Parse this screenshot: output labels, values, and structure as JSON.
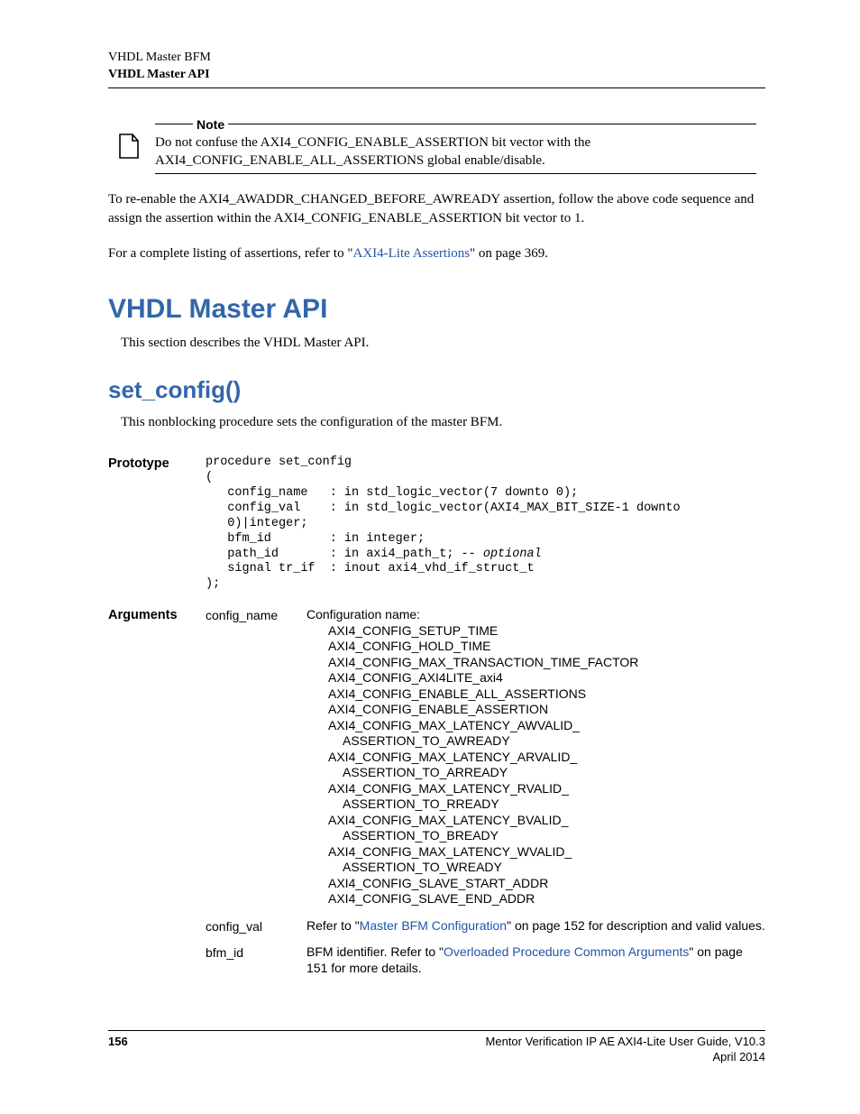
{
  "header": {
    "line1": "VHDL Master BFM",
    "line2": "VHDL Master API"
  },
  "note": {
    "label": "Note",
    "body": "Do not confuse the AXI4_CONFIG_ENABLE_ASSERTION bit vector with the AXI4_CONFIG_ENABLE_ALL_ASSERTIONS global enable/disable."
  },
  "para1": "To re-enable the AXI4_AWADDR_CHANGED_BEFORE_AWREADY assertion, follow the above code sequence and assign the assertion within the AXI4_CONFIG_ENABLE_ASSERTION bit vector to 1.",
  "para2_a": "For a complete listing of assertions, refer to \"",
  "para2_link": "AXI4-Lite Assertions",
  "para2_b": "\" on page 369.",
  "h1": "VHDL Master API",
  "h1_intro": "This section describes the VHDL Master API.",
  "h2": "set_config()",
  "h2_intro": "This nonblocking procedure sets the configuration of the master BFM.",
  "proto_label": "Prototype",
  "proto_code_a": "procedure set_config\n(\n   config_name   : in std_logic_vector(7 downto 0);\n   config_val    : in std_logic_vector(AXI4_MAX_BIT_SIZE-1 downto \n   0)|integer;\n   bfm_id        : in integer;\n   path_id       : in axi4_path_t; ",
  "proto_code_optional": "-- optional",
  "proto_code_b": "\n   signal tr_if  : inout axi4_vhd_if_struct_t\n);",
  "args_label": "Arguments",
  "args": {
    "config_name": {
      "name": "config_name",
      "intro": "Configuration name:",
      "list": [
        "AXI4_CONFIG_SETUP_TIME",
        "AXI4_CONFIG_HOLD_TIME",
        "AXI4_CONFIG_MAX_TRANSACTION_TIME_FACTOR",
        "AXI4_CONFIG_AXI4LITE_axi4",
        "AXI4_CONFIG_ENABLE_ALL_ASSERTIONS",
        "AXI4_CONFIG_ENABLE_ASSERTION",
        "AXI4_CONFIG_MAX_LATENCY_AWVALID_",
        "   ASSERTION_TO_AWREADY",
        "AXI4_CONFIG_MAX_LATENCY_ARVALID_",
        "   ASSERTION_TO_ARREADY",
        "AXI4_CONFIG_MAX_LATENCY_RVALID_",
        "   ASSERTION_TO_RREADY",
        "AXI4_CONFIG_MAX_LATENCY_BVALID_",
        "   ASSERTION_TO_BREADY",
        "AXI4_CONFIG_MAX_LATENCY_WVALID_",
        "   ASSERTION_TO_WREADY",
        "AXI4_CONFIG_SLAVE_START_ADDR",
        "AXI4_CONFIG_SLAVE_END_ADDR"
      ]
    },
    "config_val": {
      "name": "config_val",
      "a": "Refer to \"",
      "link": "Master BFM Configuration",
      "b": "\" on page 152 for description and valid values."
    },
    "bfm_id": {
      "name": "bfm_id",
      "a": "BFM identifier. Refer to \"",
      "link": "Overloaded Procedure Common Arguments",
      "b": "\" on page 151 for more details."
    }
  },
  "footer": {
    "page": "156",
    "title": "Mentor Verification IP AE AXI4-Lite User Guide, V10.3",
    "date": "April 2014"
  }
}
